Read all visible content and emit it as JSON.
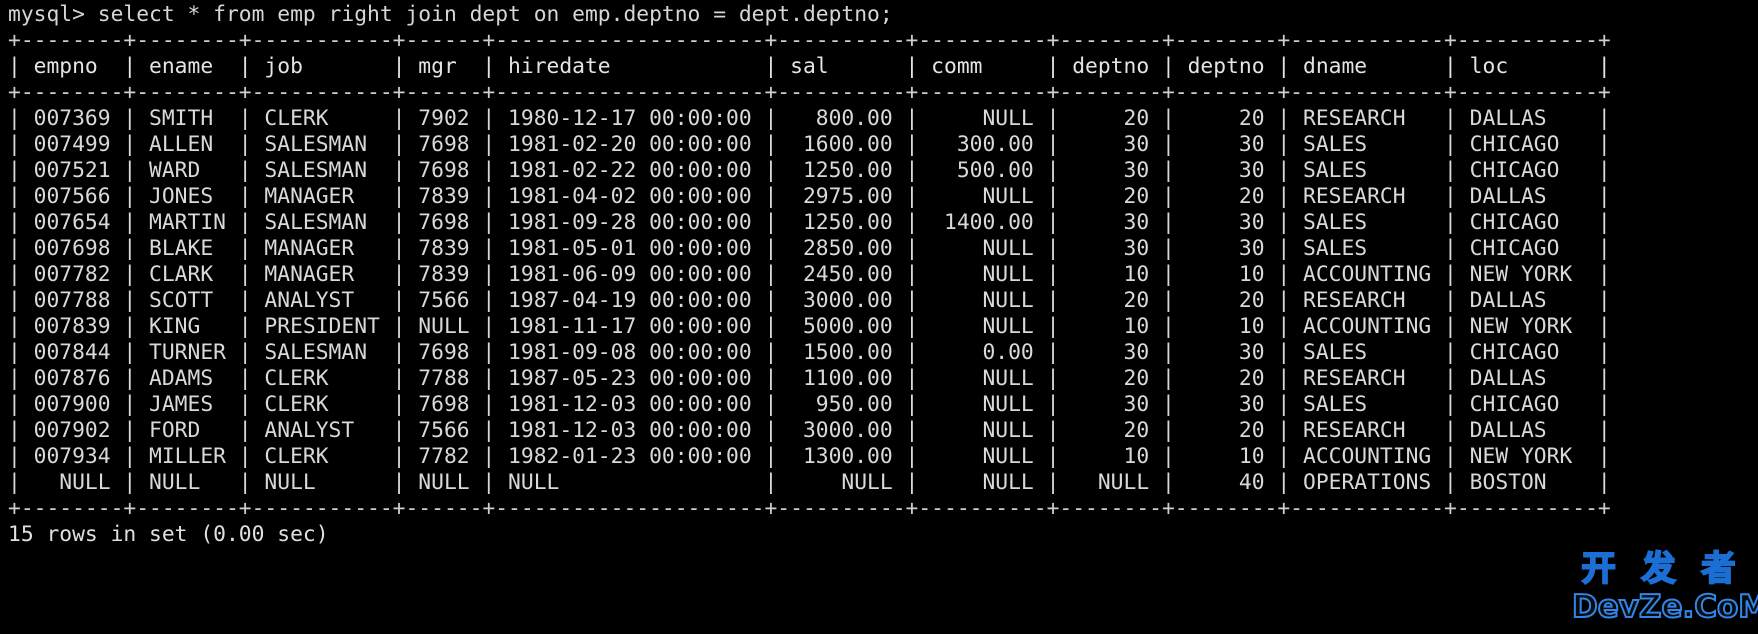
{
  "terminal": {
    "background_color": "#000000",
    "text_color": "#d6d6d6",
    "prompt": "mysql> ",
    "query": "select * from emp right join dept on emp.deptno = dept.deptno;",
    "prompt_line": "mysql> select * from emp right join dept on emp.deptno = dept.deptno;",
    "status": "15 rows in set (0.00 sec)"
  },
  "table": {
    "columns": [
      {
        "name": "empno",
        "width": 8,
        "align": "right"
      },
      {
        "name": "ename",
        "width": 8,
        "align": "left"
      },
      {
        "name": "job",
        "width": 11,
        "align": "left"
      },
      {
        "name": "mgr",
        "width": 6,
        "align": "right"
      },
      {
        "name": "hiredate",
        "width": 21,
        "align": "left"
      },
      {
        "name": "sal",
        "width": 10,
        "align": "right"
      },
      {
        "name": "comm",
        "width": 10,
        "align": "right"
      },
      {
        "name": "deptno",
        "width": 8,
        "align": "right"
      },
      {
        "name": "deptno",
        "width": 8,
        "align": "right"
      },
      {
        "name": "dname",
        "width": 12,
        "align": "left"
      },
      {
        "name": "loc",
        "width": 11,
        "align": "left"
      }
    ],
    "headers": [
      "empno",
      "ename",
      "job",
      "mgr",
      "hiredate",
      "sal",
      "comm",
      "deptno",
      "deptno",
      "dname",
      "loc"
    ],
    "rows": [
      [
        "007369",
        "SMITH",
        "CLERK",
        "7902",
        "1980-12-17 00:00:00",
        "800.00",
        "NULL",
        "20",
        "20",
        "RESEARCH",
        "DALLAS"
      ],
      [
        "007499",
        "ALLEN",
        "SALESMAN",
        "7698",
        "1981-02-20 00:00:00",
        "1600.00",
        "300.00",
        "30",
        "30",
        "SALES",
        "CHICAGO"
      ],
      [
        "007521",
        "WARD",
        "SALESMAN",
        "7698",
        "1981-02-22 00:00:00",
        "1250.00",
        "500.00",
        "30",
        "30",
        "SALES",
        "CHICAGO"
      ],
      [
        "007566",
        "JONES",
        "MANAGER",
        "7839",
        "1981-04-02 00:00:00",
        "2975.00",
        "NULL",
        "20",
        "20",
        "RESEARCH",
        "DALLAS"
      ],
      [
        "007654",
        "MARTIN",
        "SALESMAN",
        "7698",
        "1981-09-28 00:00:00",
        "1250.00",
        "1400.00",
        "30",
        "30",
        "SALES",
        "CHICAGO"
      ],
      [
        "007698",
        "BLAKE",
        "MANAGER",
        "7839",
        "1981-05-01 00:00:00",
        "2850.00",
        "NULL",
        "30",
        "30",
        "SALES",
        "CHICAGO"
      ],
      [
        "007782",
        "CLARK",
        "MANAGER",
        "7839",
        "1981-06-09 00:00:00",
        "2450.00",
        "NULL",
        "10",
        "10",
        "ACCOUNTING",
        "NEW YORK"
      ],
      [
        "007788",
        "SCOTT",
        "ANALYST",
        "7566",
        "1987-04-19 00:00:00",
        "3000.00",
        "NULL",
        "20",
        "20",
        "RESEARCH",
        "DALLAS"
      ],
      [
        "007839",
        "KING",
        "PRESIDENT",
        "NULL",
        "1981-11-17 00:00:00",
        "5000.00",
        "NULL",
        "10",
        "10",
        "ACCOUNTING",
        "NEW YORK"
      ],
      [
        "007844",
        "TURNER",
        "SALESMAN",
        "7698",
        "1981-09-08 00:00:00",
        "1500.00",
        "0.00",
        "30",
        "30",
        "SALES",
        "CHICAGO"
      ],
      [
        "007876",
        "ADAMS",
        "CLERK",
        "7788",
        "1987-05-23 00:00:00",
        "1100.00",
        "NULL",
        "20",
        "20",
        "RESEARCH",
        "DALLAS"
      ],
      [
        "007900",
        "JAMES",
        "CLERK",
        "7698",
        "1981-12-03 00:00:00",
        "950.00",
        "NULL",
        "30",
        "30",
        "SALES",
        "CHICAGO"
      ],
      [
        "007902",
        "FORD",
        "ANALYST",
        "7566",
        "1981-12-03 00:00:00",
        "3000.00",
        "NULL",
        "20",
        "20",
        "RESEARCH",
        "DALLAS"
      ],
      [
        "007934",
        "MILLER",
        "CLERK",
        "7782",
        "1982-01-23 00:00:00",
        "1300.00",
        "NULL",
        "10",
        "10",
        "ACCOUNTING",
        "NEW YORK"
      ],
      [
        "NULL",
        "NULL",
        "NULL",
        "NULL",
        "NULL",
        "NULL",
        "NULL",
        "NULL",
        "40",
        "OPERATIONS",
        "BOSTON"
      ]
    ],
    "null_row_index": 14,
    "null_row_alignment_note": "In the NULL row, empno/sal/comm/deptno are right-aligned; ename/job/mgr/hiredate render NULL left-aligned."
  },
  "watermark": {
    "chinese": "开 发 者",
    "latin": "DevZe.CoM",
    "color": "#2f86e8"
  }
}
